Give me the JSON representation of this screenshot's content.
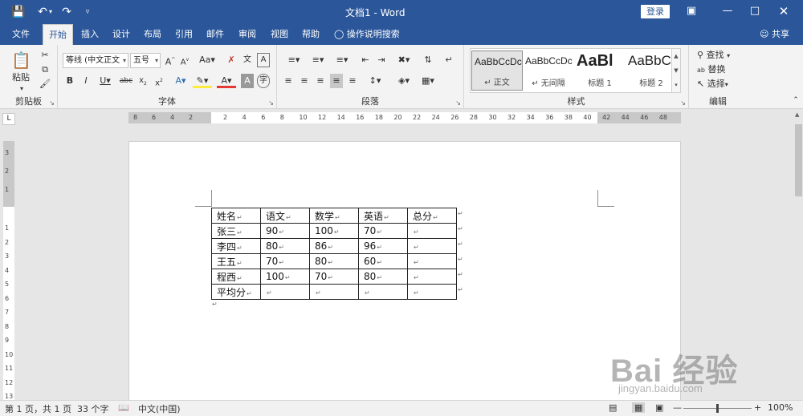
{
  "window": {
    "title": "文档1  -  Word",
    "login_label": "登录"
  },
  "tabs": [
    {
      "label": "文件"
    },
    {
      "label": "开始"
    },
    {
      "label": "插入"
    },
    {
      "label": "设计"
    },
    {
      "label": "布局"
    },
    {
      "label": "引用"
    },
    {
      "label": "邮件"
    },
    {
      "label": "审阅"
    },
    {
      "label": "视图"
    },
    {
      "label": "帮助"
    }
  ],
  "tell_me": "操作说明搜索",
  "share_label": "共享",
  "ribbon": {
    "clipboard": {
      "label": "剪贴板",
      "paste": "粘贴"
    },
    "font": {
      "label": "字体",
      "name": "等线 (中文正文",
      "size": "五号"
    },
    "paragraph": {
      "label": "段落"
    },
    "styles": {
      "label": "样式",
      "items": [
        {
          "sample": "AaBbCcDc",
          "name": "↵ 正文"
        },
        {
          "sample": "AaBbCcDc",
          "name": "↵ 无间隔"
        },
        {
          "sample": "AaBl",
          "name": "标题 1"
        },
        {
          "sample": "AaBbC",
          "name": "标题 2"
        }
      ]
    },
    "editing": {
      "label": "编辑",
      "find": "查找",
      "replace": "替换",
      "select": "选择"
    }
  },
  "ruler": {
    "h_left": [
      "8",
      "6",
      "4",
      "2"
    ],
    "h_main": [
      "2",
      "4",
      "6",
      "8",
      "10",
      "12",
      "14",
      "16",
      "18",
      "20",
      "22",
      "24",
      "26",
      "28",
      "30",
      "32",
      "34",
      "36",
      "38",
      "40",
      "42",
      "44",
      "46",
      "48"
    ],
    "v_top": [
      "3",
      "2",
      "1"
    ],
    "v_main": [
      "1",
      "2",
      "3",
      "4",
      "5",
      "6",
      "7",
      "8",
      "9",
      "10",
      "11",
      "12",
      "13"
    ]
  },
  "table": {
    "rows": [
      [
        "姓名",
        "语文",
        "数学",
        "英语",
        "总分"
      ],
      [
        "张三",
        "90",
        "100",
        "70",
        ""
      ],
      [
        "李四",
        "80",
        "86",
        "96",
        ""
      ],
      [
        "王五",
        "70",
        "80",
        "60",
        ""
      ],
      [
        "程西",
        "100",
        "70",
        "80",
        ""
      ],
      [
        "平均分",
        "",
        "",
        "",
        ""
      ]
    ]
  },
  "status": {
    "page": "第 1 页，共 1 页",
    "words": "33 个字",
    "lang": "中文(中国)",
    "zoom": "100%"
  },
  "watermark": {
    "text": "Bai 经验",
    "url": "jingyan.baidu.com"
  }
}
